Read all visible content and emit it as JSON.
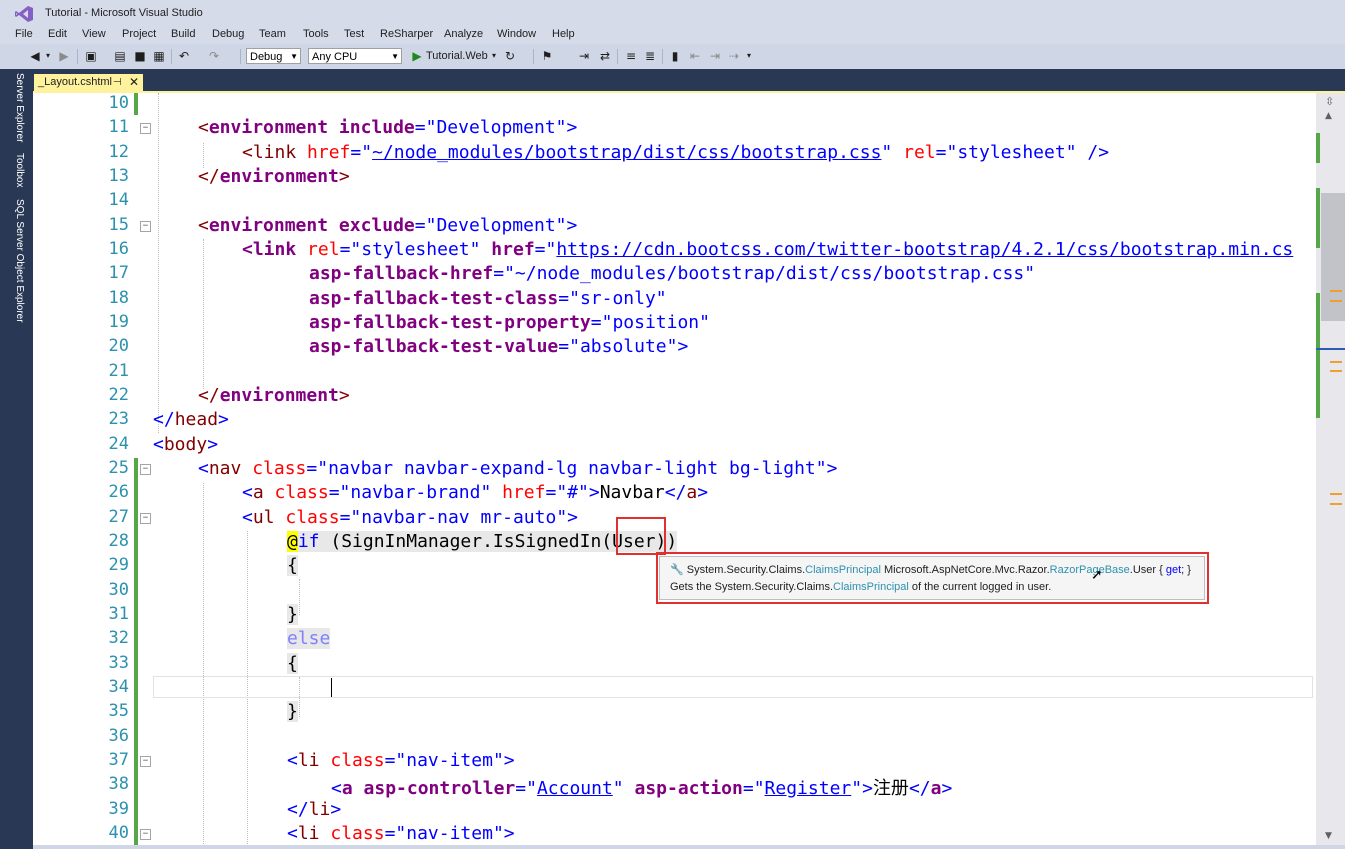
{
  "window": {
    "title": "Tutorial - Microsoft Visual Studio"
  },
  "menu": [
    "File",
    "Edit",
    "View",
    "Project",
    "Build",
    "Debug",
    "Team",
    "Tools",
    "Test",
    "ReSharper",
    "Analyze",
    "Window",
    "Help"
  ],
  "toolbar": {
    "configuration": "Debug",
    "platform": "Any CPU",
    "start_target": "Tutorial.Web"
  },
  "side_tabs": [
    "Server Explorer",
    "Toolbox",
    "SQL Server Object Explorer"
  ],
  "document_tab": {
    "name": "_Layout.cshtml",
    "pin": "⊣",
    "close": "✕"
  },
  "editor": {
    "lines": [
      {
        "n": "10"
      },
      {
        "n": "11"
      },
      {
        "n": "12"
      },
      {
        "n": "13"
      },
      {
        "n": "14"
      },
      {
        "n": "15"
      },
      {
        "n": "16"
      },
      {
        "n": "17"
      },
      {
        "n": "18"
      },
      {
        "n": "19"
      },
      {
        "n": "20"
      },
      {
        "n": "21"
      },
      {
        "n": "22"
      },
      {
        "n": "23"
      },
      {
        "n": "24"
      },
      {
        "n": "25"
      },
      {
        "n": "26"
      },
      {
        "n": "27"
      },
      {
        "n": "28"
      },
      {
        "n": "29"
      },
      {
        "n": "30"
      },
      {
        "n": "31"
      },
      {
        "n": "32"
      },
      {
        "n": "33"
      },
      {
        "n": "34"
      },
      {
        "n": "35"
      },
      {
        "n": "36"
      },
      {
        "n": "37"
      },
      {
        "n": "38"
      },
      {
        "n": "39"
      },
      {
        "n": "40"
      }
    ],
    "code": {
      "l11": [
        "<",
        "environment",
        " include",
        "=\"",
        "Development",
        "\">"
      ],
      "l12": [
        "<",
        "link",
        " href",
        "=\"",
        "~/node_modules/bootstrap/dist/css/bootstrap.css",
        "\"",
        " rel",
        "=\"",
        "stylesheet",
        "\" />"
      ],
      "l13": [
        "</",
        "environment",
        ">"
      ],
      "l15": [
        "<",
        "environment",
        " exclude",
        "=\"",
        "Development",
        "\">"
      ],
      "l16": [
        "<",
        "link",
        " rel",
        "=\"",
        "stylesheet",
        "\"",
        " href",
        "=\"",
        "https://cdn.bootcss.com/twitter-bootstrap/4.2.1/css/bootstrap.min.cs"
      ],
      "l17": [
        "asp-fallback-href",
        "=\"",
        "~/node_modules/bootstrap/dist/css/bootstrap.css",
        "\""
      ],
      "l18": [
        "asp-fallback-test-class",
        "=\"",
        "sr-only",
        "\""
      ],
      "l19": [
        "asp-fallback-test-property",
        "=\"",
        "position",
        "\""
      ],
      "l20": [
        "asp-fallback-test-value",
        "=\"",
        "absolute",
        "\">"
      ],
      "l22": [
        "</",
        "environment",
        ">"
      ],
      "l23": [
        "</",
        "head",
        ">"
      ],
      "l24": [
        "<",
        "body",
        ">"
      ],
      "l25": [
        "<",
        "nav",
        " class",
        "=\"",
        "navbar navbar-expand-lg navbar-light bg-light",
        "\">"
      ],
      "l26": [
        "<",
        "a",
        " class",
        "=\"",
        "navbar-brand",
        "\"",
        " href",
        "=\"",
        "#",
        "\">",
        "Navbar",
        "</",
        "a",
        ">"
      ],
      "l27": [
        "<",
        "ul",
        " class",
        "=\"",
        "navbar-nav mr-auto",
        "\">"
      ],
      "l28": [
        "@",
        "if",
        " (SignInManager.IsSignedIn(",
        "User",
        "))"
      ],
      "l29": [
        "{"
      ],
      "l31": [
        "}"
      ],
      "l32": [
        "else"
      ],
      "l33": [
        "{"
      ],
      "l35": [
        "}"
      ],
      "l37": [
        "<",
        "li",
        " class",
        "=\"",
        "nav-item",
        "\">"
      ],
      "l38": [
        "<",
        "a",
        " asp-controller",
        "=\"",
        "Account",
        "\"",
        " asp-action",
        "=\"",
        "Register",
        "\">",
        "注册",
        "</",
        "a",
        ">"
      ],
      "l39": [
        "</",
        "li",
        ">"
      ],
      "l40": [
        "<",
        "li",
        " class",
        "=\"",
        "nav-item",
        "\">"
      ]
    }
  },
  "tooltip": {
    "icon": "🔧",
    "row1": [
      "System.Security.Claims.",
      "ClaimsPrincipal",
      " Microsoft.AspNetCore.Mvc.Razor.",
      "RazorPageBase",
      ".User { ",
      "get",
      "; }"
    ],
    "row2": [
      "Gets the System.Security.Claims.",
      "ClaimsPrincipal",
      " of the current logged in user."
    ]
  },
  "colors": {
    "accent": "#e03131",
    "tab_active": "#fff29d",
    "changebar": "#57a64a"
  }
}
